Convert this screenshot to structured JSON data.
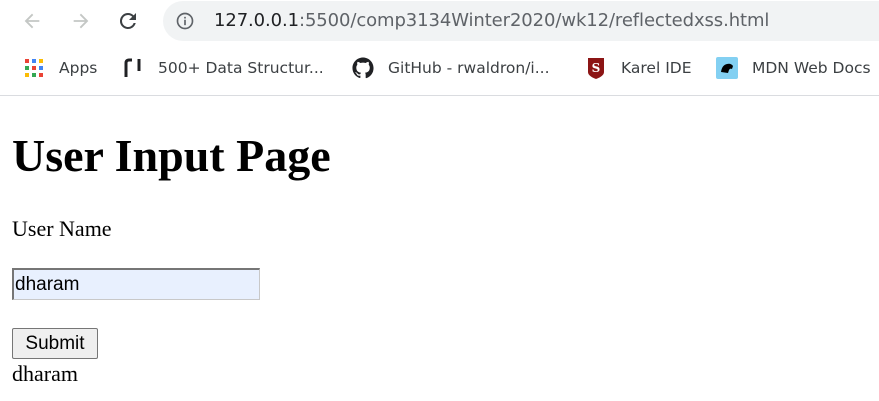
{
  "browser": {
    "url": {
      "host": "127.0.0.1",
      "rest": ":5500/comp3134Winter2020/wk12/reflectedxss.html"
    },
    "bookmarks": [
      {
        "label": "Apps",
        "icon": "apps-grid-icon"
      },
      {
        "label": "500+ Data Structur...",
        "icon": "bracket-logo-icon"
      },
      {
        "label": "GitHub - rwaldron/i...",
        "icon": "github-icon"
      },
      {
        "label": "Karel IDE",
        "icon": "stanford-icon"
      },
      {
        "label": "MDN Web Docs",
        "icon": "mdn-icon"
      }
    ],
    "accent": "#1a73e8"
  },
  "page": {
    "heading": "User Input Page",
    "field_label": "User Name",
    "input_value": "dharam",
    "submit_label": "Submit",
    "echo_output": "dharam"
  }
}
